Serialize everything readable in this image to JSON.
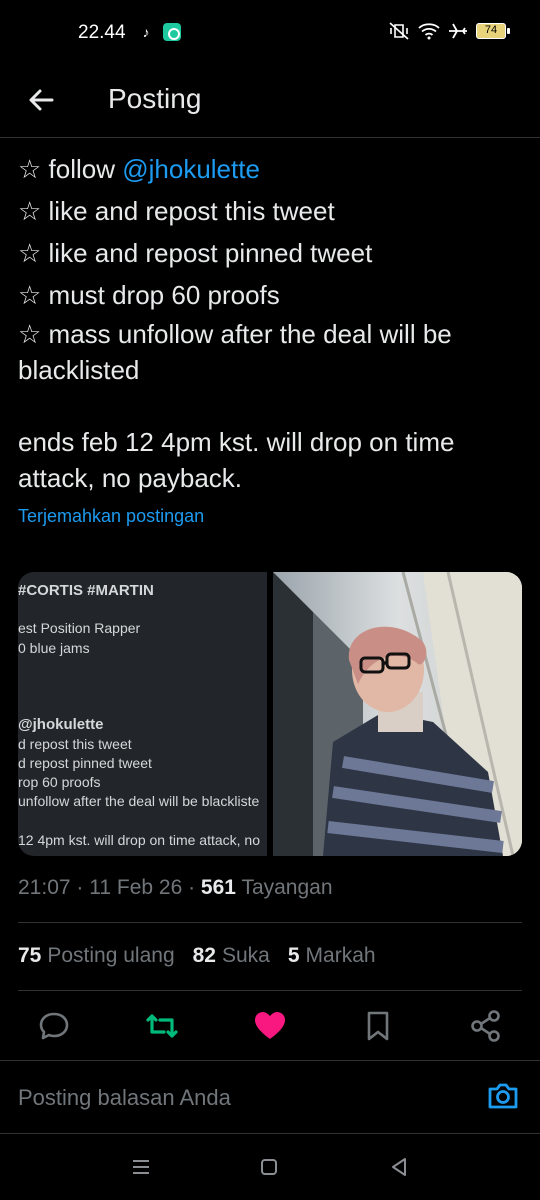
{
  "status_bar": {
    "time": "22.44",
    "battery": "74"
  },
  "header": {
    "title": "Posting"
  },
  "tweet": {
    "lines": [
      {
        "prefix": "☆ follow ",
        "mention": "@jhokulette"
      },
      {
        "text": "☆ like and repost this tweet"
      },
      {
        "text": "☆ like and repost pinned tweet"
      },
      {
        "text": "☆ must drop 60 proofs"
      },
      {
        "text": "☆ mass unfollow after the deal will be blacklisted"
      }
    ],
    "ends": "ends feb 12 4pm kst. will drop on time attack, no payback.",
    "translate": "Terjemahkan postingan"
  },
  "media": {
    "screenshot_lines": [
      "#CORTIS #MARTIN",
      "est Position Rapper",
      "0 blue jams",
      "@jhokulette",
      "d repost this tweet",
      "d repost pinned tweet",
      "rop 60 proofs",
      "unfollow after the deal will be blackliste",
      "12 4pm kst. will drop on time attack, no"
    ]
  },
  "meta": {
    "time": "21:07",
    "date": "11 Feb 26",
    "views": "561",
    "views_label": "Tayangan"
  },
  "stats": {
    "reposts": "75",
    "reposts_label": "Posting ulang",
    "likes": "82",
    "likes_label": "Suka",
    "bookmarks": "5",
    "bookmarks_label": "Markah"
  },
  "reply": {
    "placeholder": "Posting balasan Anda"
  },
  "colors": {
    "accent": "#1d9bf0",
    "repost_green": "#00ba7c",
    "like_pink": "#f91880"
  }
}
